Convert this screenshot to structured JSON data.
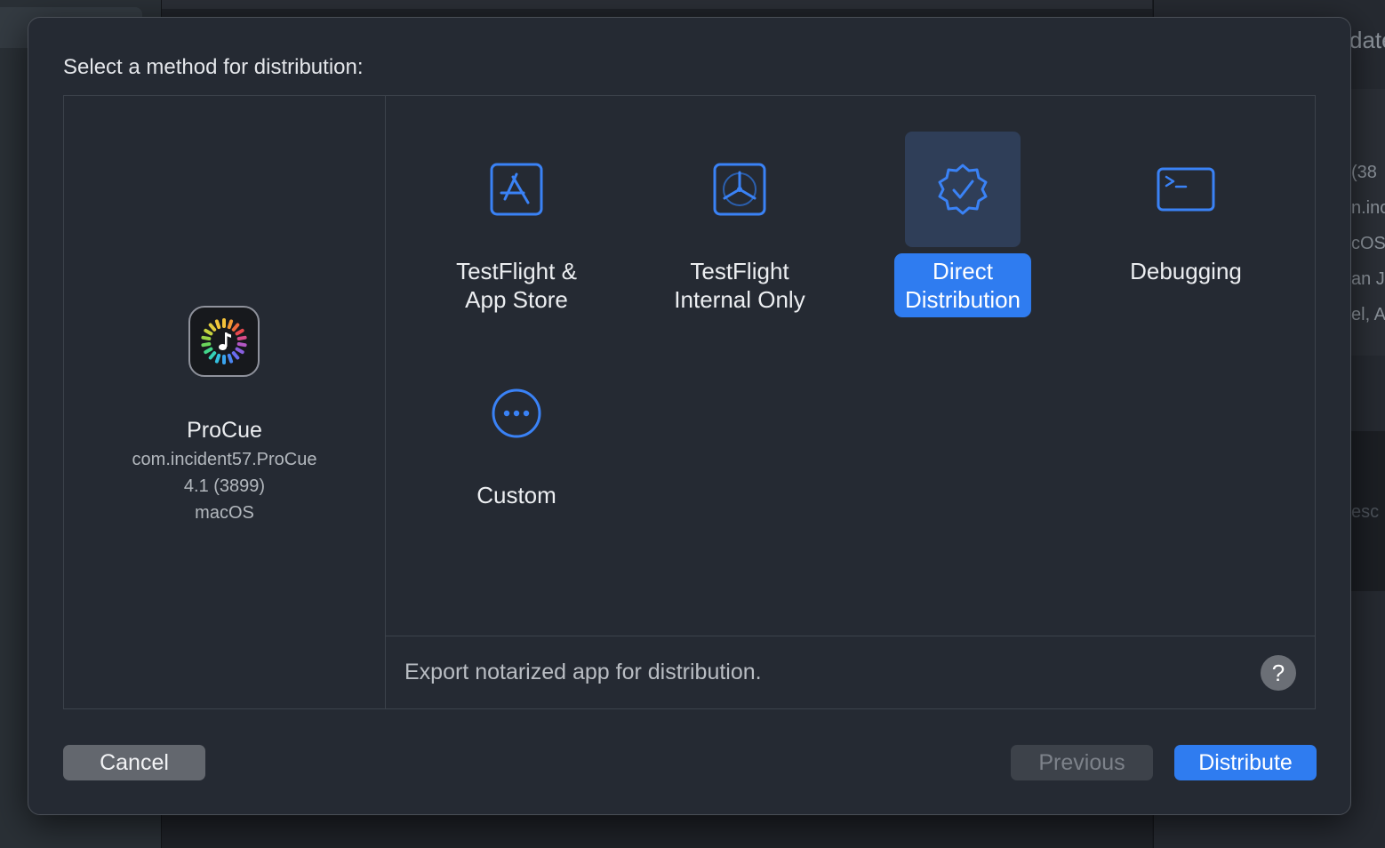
{
  "background": {
    "peek_texts": [
      "date",
      "(38",
      "n.inc",
      "cOS",
      "an J",
      "el, A",
      "esc"
    ]
  },
  "sheet": {
    "title": "Select a method for distribution:",
    "app": {
      "name": "ProCue",
      "bundle_id": "com.incident57.ProCue",
      "version": "4.1 (3899)",
      "platform": "macOS"
    },
    "methods": [
      {
        "line1": "TestFlight &",
        "line2": "App Store",
        "icon": "app-store-icon",
        "selected": false
      },
      {
        "line1": "TestFlight",
        "line2": "Internal Only",
        "icon": "testflight-icon",
        "selected": false
      },
      {
        "line1": "Direct",
        "line2": "Distribution",
        "icon": "verified-badge-icon",
        "selected": true
      },
      {
        "line1": "Debugging",
        "line2": "",
        "icon": "terminal-icon",
        "selected": false
      },
      {
        "line1": "Custom",
        "line2": "",
        "icon": "ellipsis-circle-icon",
        "selected": false
      }
    ],
    "description": "Export notarized app for distribution.",
    "help_label": "?",
    "buttons": {
      "cancel": "Cancel",
      "previous": "Previous",
      "distribute": "Distribute"
    }
  },
  "colors": {
    "accent": "#2f7cf0",
    "sheet_bg": "#252a33",
    "icon_blue": "#3a82f6",
    "selected_tile": "#2f3e58"
  }
}
